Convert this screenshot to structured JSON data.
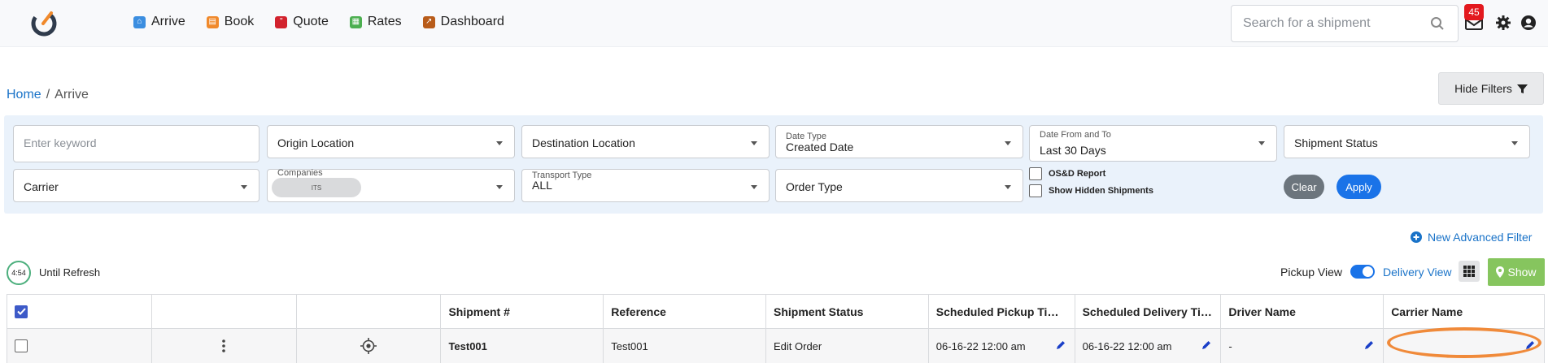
{
  "nav": {
    "items": [
      {
        "label": "Arrive",
        "icon": "home-icon",
        "color": "#3b8ee0"
      },
      {
        "label": "Book",
        "icon": "book-icon",
        "color": "#f0892b"
      },
      {
        "label": "Quote",
        "icon": "quote-icon",
        "color": "#d2222d"
      },
      {
        "label": "Rates",
        "icon": "rates-icon",
        "color": "#4caf50"
      },
      {
        "label": "Dashboard",
        "icon": "chart-icon",
        "color": "#b85c1a"
      }
    ],
    "search_placeholder": "Search for a shipment",
    "notification_count": "45"
  },
  "breadcrumb": {
    "home": "Home",
    "separator": "/",
    "current": "Arrive"
  },
  "hide_filters_label": "Hide Filters",
  "filters": {
    "keyword_placeholder": "Enter keyword",
    "origin": "Origin Location",
    "destination": "Destination Location",
    "date_type_label": "Date Type",
    "date_type": "Created Date",
    "date_range_label": "Date From and To",
    "date_range": "Last 30 Days",
    "shipment_status": "Shipment Status",
    "carrier": "Carrier",
    "companies_label": "Companies",
    "company_chip": "ITS",
    "transport_type_label": "Transport Type",
    "transport_type": "ALL",
    "order_type": "Order Type",
    "osd_report": "OS&D Report",
    "show_hidden": "Show Hidden Shipments",
    "clear": "Clear",
    "apply": "Apply"
  },
  "advanced_filter_label": "New Advanced Filter",
  "refresh": {
    "timer": "4:54",
    "label": "Until Refresh"
  },
  "view": {
    "pickup": "Pickup View",
    "delivery": "Delivery View",
    "show": "Show"
  },
  "table": {
    "headers": [
      "",
      "",
      "",
      "Shipment #",
      "Reference",
      "Shipment Status",
      "Scheduled Pickup Time...",
      "Scheduled Delivery Tim...",
      "Driver Name",
      "Carrier Name"
    ],
    "rows": [
      {
        "shipment": "Test001",
        "reference": "Test001",
        "status": "Edit Order",
        "pickup": "06-16-22 12:00 am",
        "delivery": "06-16-22 12:00 am",
        "driver": "-",
        "carrier": "-"
      }
    ]
  }
}
